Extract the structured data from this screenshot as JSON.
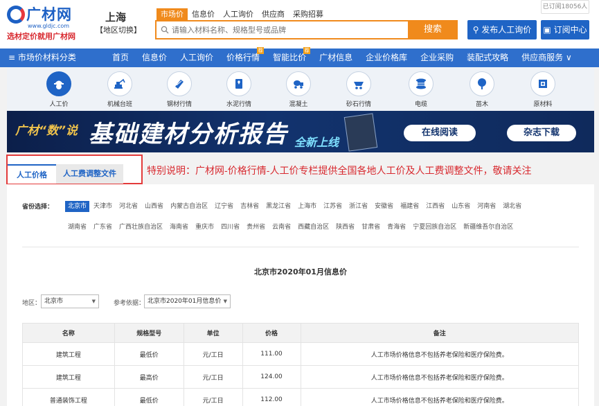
{
  "header": {
    "logo_main": "广材网",
    "logo_url": "www.gldjc.com",
    "logo_slogan": "选材定价就用广材网",
    "city": "上海",
    "city_switch": "【地区切换】",
    "subscribed_count": "已订阅18056人",
    "publish_button": "发布人工询价",
    "subscribe_button": "订阅中心"
  },
  "search": {
    "tabs": [
      "市场价",
      "信息价",
      "人工询价",
      "供应商",
      "采购招募"
    ],
    "placeholder": "请输入材料名称、规格型号或品牌",
    "button": "搜索"
  },
  "nav": {
    "category": "≡ 市场价材料分类",
    "items": [
      {
        "label": "首页",
        "badge": ""
      },
      {
        "label": "信息价",
        "badge": ""
      },
      {
        "label": "人工询价",
        "badge": ""
      },
      {
        "label": "价格行情",
        "badge": "荐"
      },
      {
        "label": "智能比价",
        "badge": "荐"
      },
      {
        "label": "广材信息",
        "badge": ""
      },
      {
        "label": "企业价格库",
        "badge": ""
      },
      {
        "label": "企业采购",
        "badge": ""
      },
      {
        "label": "装配式攻略",
        "badge": ""
      },
      {
        "label": "供应商服务 ∨",
        "badge": ""
      }
    ]
  },
  "categories": [
    {
      "label": "人工价",
      "icon": "worker-icon"
    },
    {
      "label": "机械台班",
      "icon": "excavator-icon"
    },
    {
      "label": "钢材行情",
      "icon": "steel-icon"
    },
    {
      "label": "水泥行情",
      "icon": "cement-icon"
    },
    {
      "label": "混凝土",
      "icon": "concrete-truck-icon"
    },
    {
      "label": "砂石行情",
      "icon": "sand-cart-icon"
    },
    {
      "label": "电缆",
      "icon": "cable-icon"
    },
    {
      "label": "苗木",
      "icon": "tree-icon"
    },
    {
      "label": "原材料",
      "icon": "raw-material-icon"
    }
  ],
  "banner": {
    "small": "广材“数”说",
    "title": "基础建材分析报告",
    "sub": "全新上线",
    "read_button": "在线阅读",
    "download_button": "杂志下载"
  },
  "tabs": [
    "人工价格",
    "人工费调整文件"
  ],
  "notice": "特别说明：广材网-价格行情-人工价专栏提供全国各地人工价及人工费调整文件，敬请关注",
  "provinces": {
    "label": "省份选择：",
    "row1": [
      "北京市",
      "天津市",
      "河北省",
      "山西省",
      "内蒙古自治区",
      "辽宁省",
      "吉林省",
      "黑龙江省",
      "上海市",
      "江苏省",
      "浙江省",
      "安徽省",
      "福建省",
      "江西省",
      "山东省",
      "河南省",
      "湖北省"
    ],
    "row2": [
      "湖南省",
      "广东省",
      "广西壮族自治区",
      "海南省",
      "重庆市",
      "四川省",
      "贵州省",
      "云南省",
      "西藏自治区",
      "陕西省",
      "甘肃省",
      "青海省",
      "宁夏回族自治区",
      "新疆维吾尔自治区"
    ],
    "selected": "北京市"
  },
  "page_title": "北京市2020年01月信息价",
  "filters": {
    "region_label": "地区：",
    "region_value": "北京市",
    "basis_label": "参考依据：",
    "basis_value": "北京市2020年01月信息价"
  },
  "table": {
    "headers": [
      "名称",
      "规格型号",
      "单位",
      "价格",
      "备注"
    ],
    "rows": [
      [
        "建筑工程",
        "最低价",
        "元/工日",
        "111.00",
        "人工市场价格信息不包括养老保险和医疗保险费。"
      ],
      [
        "建筑工程",
        "最高价",
        "元/工日",
        "124.00",
        "人工市场价格信息不包括养老保险和医疗保险费。"
      ],
      [
        "普通装饰工程",
        "最低价",
        "元/工日",
        "112.00",
        "人工市场价格信息不包括养老保险和医疗保险费。"
      ]
    ]
  },
  "colors": {
    "brand_blue": "#1f64c5",
    "brand_orange": "#f08a1c",
    "alert_red": "#d8292f"
  }
}
